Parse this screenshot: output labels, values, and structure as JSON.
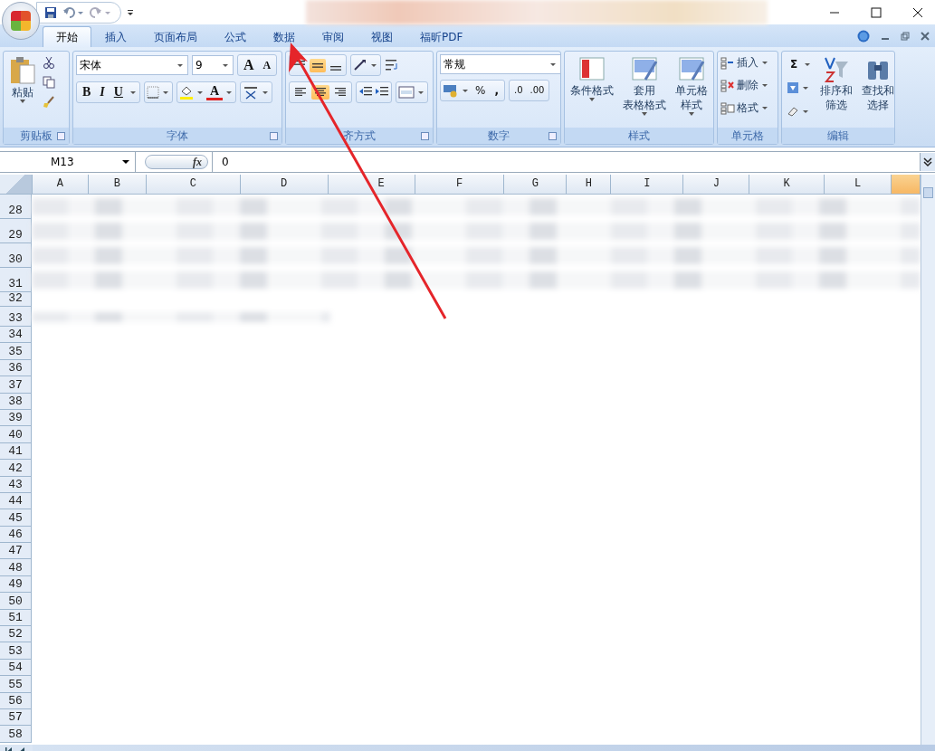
{
  "tabs": [
    {
      "label": "开始",
      "selected": true
    },
    {
      "label": "插入",
      "selected": false
    },
    {
      "label": "页面布局",
      "selected": false
    },
    {
      "label": "公式",
      "selected": false
    },
    {
      "label": "数据",
      "selected": false
    },
    {
      "label": "审阅",
      "selected": false
    },
    {
      "label": "视图",
      "selected": false
    },
    {
      "label": "福昕PDF",
      "selected": false
    }
  ],
  "ribbon": {
    "clipboard": {
      "label": "剪贴板",
      "paste": "粘贴"
    },
    "font": {
      "label": "字体",
      "font_name": "宋体",
      "font_size": "9",
      "grow": "A",
      "shrink": "A",
      "bold": "B",
      "italic": "I",
      "underline": "U",
      "font_color": "A"
    },
    "alignment": {
      "label": "齐方式",
      "vertical": [
        {
          "selected": false
        },
        {
          "selected": true
        },
        {
          "selected": false
        }
      ],
      "horizontal": [
        {
          "selected": false
        },
        {
          "selected": true
        },
        {
          "selected": false
        }
      ]
    },
    "number": {
      "label": "数字",
      "format": "常规",
      "percent": "%",
      "comma": ",",
      "decimals": [
        ".0",
        ".00"
      ]
    },
    "styles": {
      "label": "样式",
      "buttons": [
        [
          "条件格式"
        ],
        [
          "套用",
          "表格格式"
        ],
        [
          "单元格",
          "样式"
        ]
      ]
    },
    "cells": {
      "label": "单元格",
      "buttons": [
        "插入",
        "删除",
        "格式"
      ]
    },
    "editing": {
      "label": "编辑",
      "sum": "Σ",
      "buttons": [
        [
          "排序和",
          "筛选"
        ],
        [
          "查找和",
          "选择"
        ]
      ]
    }
  },
  "formula_bar": {
    "name_box": "M13",
    "fx": "fx",
    "value": "0"
  },
  "columns": [
    "A",
    "B",
    "C",
    "D",
    "E",
    "F",
    "G",
    "H",
    "I",
    "J",
    "K",
    "L"
  ],
  "active_column": {
    "selected": true
  },
  "rows": [
    {
      "label": "28",
      "blurred": true
    },
    {
      "label": "29",
      "blurred": true
    },
    {
      "label": "30",
      "blurred": true
    },
    {
      "label": "31",
      "blurred": true
    },
    {
      "label": "32",
      "blurred": false
    },
    {
      "label": "33",
      "blurred": true
    },
    {
      "label": "34",
      "blurred": false
    },
    {
      "label": "35",
      "blurred": false
    },
    {
      "label": "36",
      "blurred": false
    },
    {
      "label": "37",
      "blurred": false
    },
    {
      "label": "38",
      "blurred": false
    },
    {
      "label": "39",
      "blurred": false
    },
    {
      "label": "40",
      "blurred": false
    },
    {
      "label": "41",
      "blurred": false
    },
    {
      "label": "42",
      "blurred": false
    },
    {
      "label": "43",
      "blurred": false
    },
    {
      "label": "44",
      "blurred": false
    },
    {
      "label": "45",
      "blurred": false
    },
    {
      "label": "46",
      "blurred": false
    },
    {
      "label": "47",
      "blurred": false
    },
    {
      "label": "48",
      "blurred": false
    },
    {
      "label": "49",
      "blurred": false
    },
    {
      "label": "50",
      "blurred": false
    },
    {
      "label": "51",
      "blurred": false
    },
    {
      "label": "52",
      "blurred": false
    },
    {
      "label": "53",
      "blurred": false
    },
    {
      "label": "54",
      "blurred": false
    },
    {
      "label": "55",
      "blurred": false
    },
    {
      "label": "56",
      "blurred": false
    },
    {
      "label": "57",
      "blurred": false
    },
    {
      "label": "58",
      "blurred": false
    }
  ]
}
